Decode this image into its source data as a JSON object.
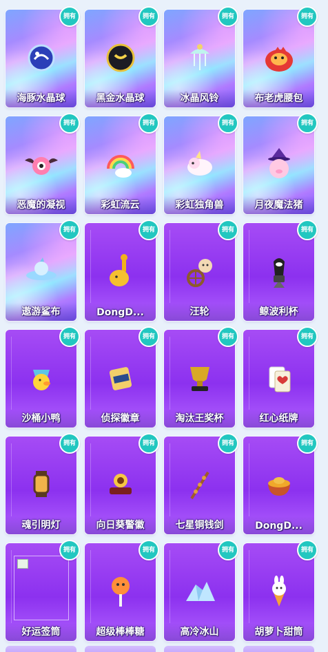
{
  "badge_label": "拥有",
  "items": [
    {
      "label": "海豚水晶球",
      "style": "holo",
      "icon": "crystal-ball-icon"
    },
    {
      "label": "黑金水晶球",
      "style": "holo",
      "icon": "black-gold-orb-icon"
    },
    {
      "label": "冰晶风铃",
      "style": "holo",
      "icon": "wind-chime-icon"
    },
    {
      "label": "布老虎腰包",
      "style": "holo",
      "icon": "tiger-bag-icon"
    },
    {
      "label": "恶魔的凝视",
      "style": "holo",
      "icon": "devil-eye-icon"
    },
    {
      "label": "彩虹流云",
      "style": "holo",
      "icon": "rainbow-cloud-icon"
    },
    {
      "label": "彩虹独角兽",
      "style": "holo",
      "icon": "unicorn-icon"
    },
    {
      "label": "月夜魔法猪",
      "style": "holo",
      "icon": "magic-pig-icon"
    },
    {
      "label": "遨游鲨布",
      "style": "holo",
      "icon": "shark-ufo-icon"
    },
    {
      "label": "DongD...",
      "style": "purple",
      "icon": "rattle-icon"
    },
    {
      "label": "汪轮",
      "style": "purple",
      "icon": "dog-wheel-icon"
    },
    {
      "label": "鲸波利杯",
      "style": "purple",
      "icon": "orca-cup-icon"
    },
    {
      "label": "沙桶小鸭",
      "style": "purple",
      "icon": "duck-bucket-icon"
    },
    {
      "label": "侦探徽章",
      "style": "purple",
      "icon": "detective-badge-icon"
    },
    {
      "label": "淘汰王奖杯",
      "style": "purple",
      "icon": "trophy-icon"
    },
    {
      "label": "红心纸牌",
      "style": "purple",
      "icon": "playing-card-icon"
    },
    {
      "label": "魂引明灯",
      "style": "purple",
      "icon": "lantern-icon"
    },
    {
      "label": "向日葵警徽",
      "style": "purple",
      "icon": "sunflower-badge-icon"
    },
    {
      "label": "七星铜钱剑",
      "style": "purple",
      "icon": "coin-sword-icon"
    },
    {
      "label": "DongD...",
      "style": "purple",
      "icon": "honey-bowl-icon"
    },
    {
      "label": "好运签筒",
      "style": "purple",
      "icon": "broken-image-icon"
    },
    {
      "label": "超级棒棒糖",
      "style": "purple",
      "icon": "lollipop-icon"
    },
    {
      "label": "高冷冰山",
      "style": "purple",
      "icon": "iceberg-icon"
    },
    {
      "label": "胡萝卜甜筒",
      "style": "purple",
      "icon": "ice-cream-icon"
    }
  ]
}
